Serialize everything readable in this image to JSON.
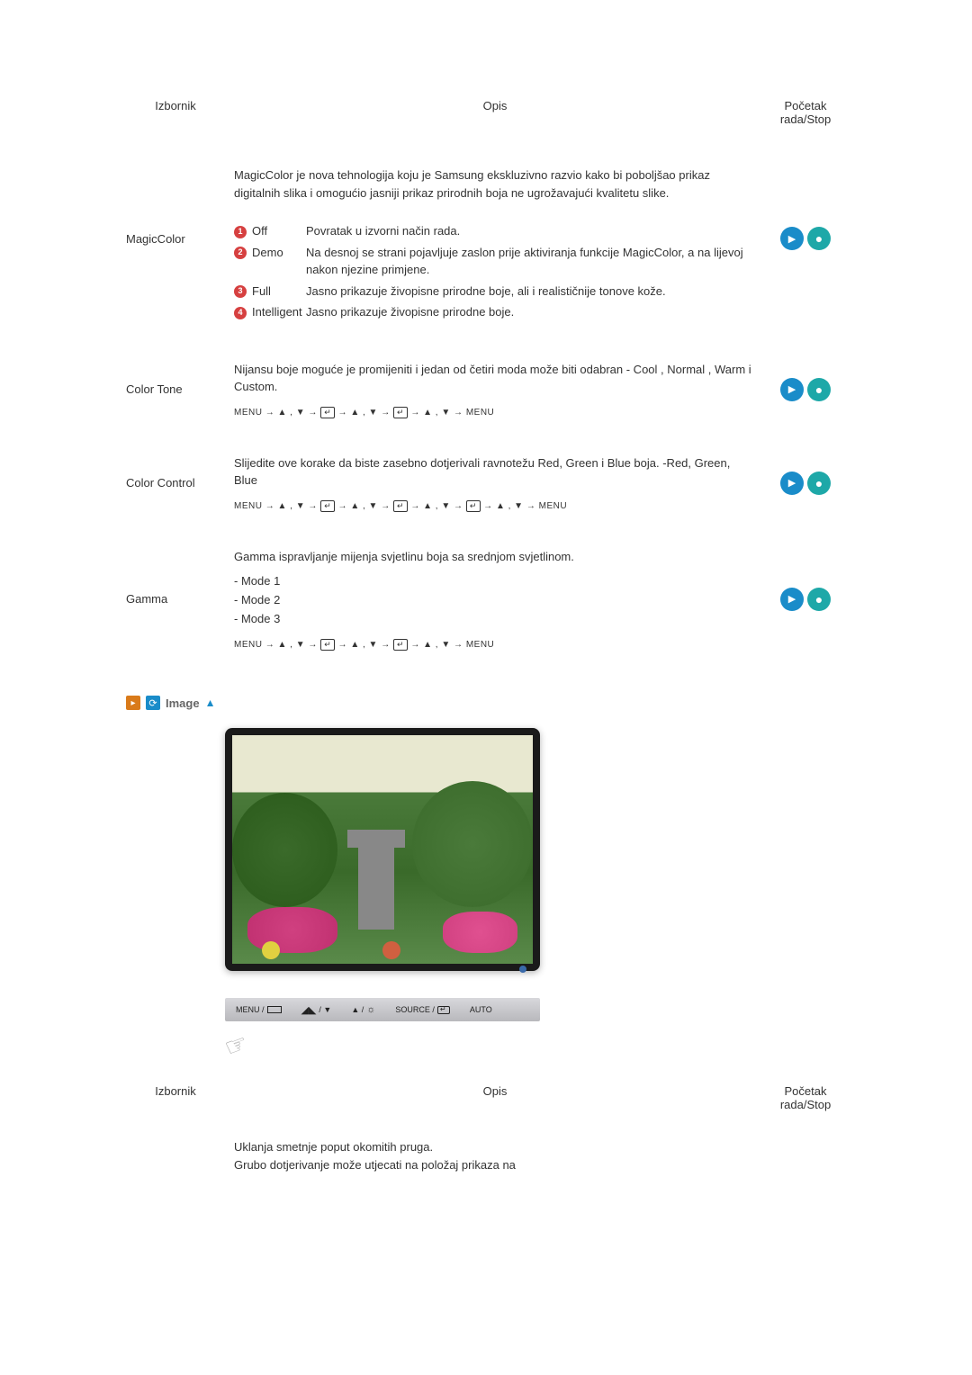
{
  "headers": {
    "izbornik": "Izbornik",
    "opis": "Opis",
    "pocetak": "Početak rada/Stop"
  },
  "magiccolor": {
    "label": "MagicColor",
    "intro": "MagicColor je nova tehnologija koju je Samsung ekskluzivno razvio kako bi poboljšao prikaz digitalnih slika i omogućio jasniji prikaz prirodnih boja ne ugrožavajući kvalitetu slike.",
    "options": [
      {
        "num": "1",
        "label": "Off",
        "desc": "Povratak u izvorni način rada."
      },
      {
        "num": "2",
        "label": "Demo",
        "desc": "Na desnoj se strani pojavljuje zaslon prije aktiviranja funkcije MagicColor, a na lijevoj nakon njezine primjene."
      },
      {
        "num": "3",
        "label": "Full",
        "desc": "Jasno prikazuje živopisne prirodne boje, ali i realističnije tonove kože."
      },
      {
        "num": "4",
        "label": "Intelligent",
        "desc": "Jasno prikazuje živopisne prirodne boje."
      }
    ]
  },
  "colortone": {
    "label": "Color Tone",
    "desc": "Nijansu boje moguće je promijeniti i jedan od četiri moda može biti odabran - Cool , Normal , Warm i Custom.",
    "nav_prefix": "MENU → ",
    "nav_mid": " → ",
    "nav_end": " → MENU",
    "updown": "▲ , ▼"
  },
  "colorcontrol": {
    "label": "Color Control",
    "desc": "Slijedite ove korake da biste zasebno dotjerivali ravnotežu Red, Green i Blue boja. -Red, Green, Blue"
  },
  "gamma": {
    "label": "Gamma",
    "desc": "Gamma ispravljanje mijenja svjetlinu boja sa srednjom svjetlinom.",
    "modes": [
      "- Mode 1",
      "- Mode 2",
      "- Mode 3"
    ]
  },
  "imagesection": {
    "title": "Image"
  },
  "buttonbar": {
    "menu": "MENU /",
    "updown1": "/ ▼",
    "updown2": "▲ /",
    "source": "SOURCE /",
    "auto": "AUTO"
  },
  "coarse": {
    "desc1": "Uklanja smetnje poput okomitih pruga.",
    "desc2": "Grubo dotjerivanje može utjecati na položaj prikaza na"
  },
  "enter_glyph": "↵"
}
